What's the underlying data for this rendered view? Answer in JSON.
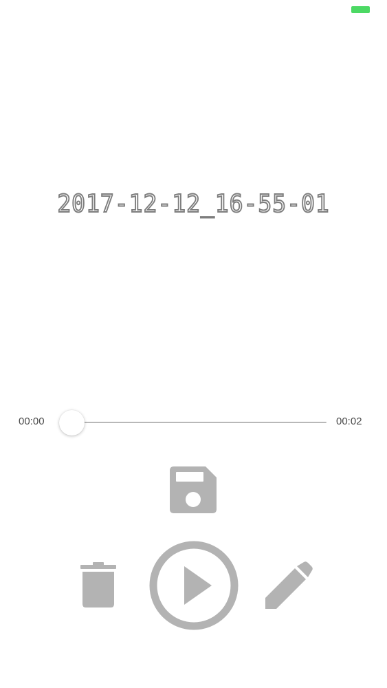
{
  "colors": {
    "battery": "#4cd964",
    "icon_gray": "#b3b3b3",
    "title_stroke": "#7d7d7d",
    "track": "#b8b8b8"
  },
  "recording": {
    "title": "2017-12-12_16-55-01"
  },
  "player": {
    "elapsed": "00:00",
    "total": "00:02",
    "progress": 0.0
  },
  "controls": {
    "save_icon": "floppy-disk-icon",
    "delete_icon": "trash-icon",
    "play_icon": "play-circle-icon",
    "edit_icon": "pencil-icon"
  }
}
